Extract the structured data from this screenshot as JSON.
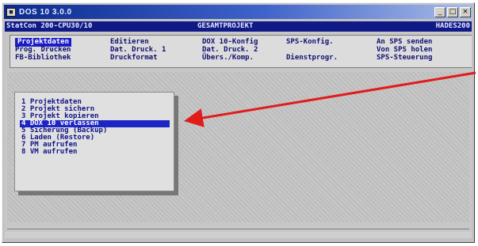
{
  "window": {
    "title": "DOS 10 3.0.0",
    "buttons": [
      "_",
      "□",
      "×"
    ]
  },
  "topbar": {
    "left": "StatCon 200-CPU30/10",
    "center": "GESAMTPROJEKT",
    "right": "HADES200"
  },
  "menu": {
    "selected_label": "Projektdaten",
    "row1": [
      "Projektdaten",
      "Editieren",
      "DOX 10-Konfig",
      "SPS-Konfig.",
      "An SPS senden"
    ],
    "row2": [
      "Prog. Drucken",
      "Dat. Druck. 1",
      "Dat. Druck. 2",
      "",
      "Von SPS holen"
    ],
    "row3": [
      "FB-Bibliothek",
      "Druckformat",
      "Übers./Komp.",
      "Dienstprogr.",
      "SPS-Steuerung"
    ]
  },
  "dropdown": {
    "items": [
      "1 Projektdaten",
      "2 Projekt sichern",
      "3 Projekt kopieren",
      "4 DOX 10 verlassen",
      "5 Sicherung (Backup)",
      "6 Laden (Restore)",
      "7 PM aufrufen",
      "8 VM aufrufen"
    ],
    "selected_index": 3
  },
  "colors": {
    "accent_blue": "#1d26c4",
    "arrow_red": "#e21b1b"
  }
}
